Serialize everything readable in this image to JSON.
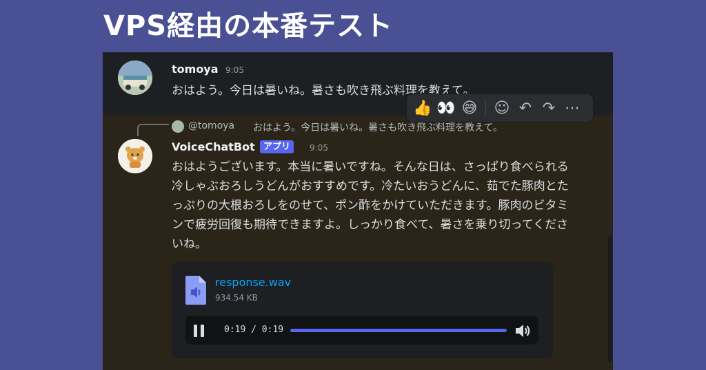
{
  "banner": {
    "title": "VPS経由の本番テスト"
  },
  "message1": {
    "author": "tomoya",
    "time": "9:05",
    "text": "おはよう。今日は暑いね。暑さも吹き飛ぶ料理を教えて。"
  },
  "toolbar": {
    "reactions": [
      "👍",
      "👀",
      "😅"
    ],
    "actions": [
      {
        "name": "add-reaction-icon",
        "glyph": "☺"
      },
      {
        "name": "reply-icon",
        "glyph": "↶"
      },
      {
        "name": "forward-icon",
        "glyph": "↷"
      },
      {
        "name": "more-icon",
        "glyph": "⋯"
      }
    ]
  },
  "message2": {
    "reply": {
      "mention": "@tomoya",
      "text": "おはよう。今日は暑いね。暑さも吹き飛ぶ料理を教えて。"
    },
    "author": "VoiceChatBot",
    "badge": "アプリ",
    "time": "9:05",
    "text": "おはようございます。本当に暑いですね。そんな日は、さっぱり食べられる冷しゃぶおろしうどんがおすすめです。冷たいおうどんに、茹でた豚肉とたっぷりの大根おろしをのせて、ポン酢をかけていただきます。豚肉のビタミンで疲労回復も期待できますよ。しっかり食べて、暑さを乗り切ってくださいね。",
    "attachment": {
      "file_name": "response.wav",
      "file_size": "934.54 KB",
      "time_display": "0:19 / 0:19",
      "progress": 1.0
    }
  },
  "colors": {
    "background": "#4a5094",
    "accent": "#5865f2",
    "link": "#00a8fc"
  }
}
